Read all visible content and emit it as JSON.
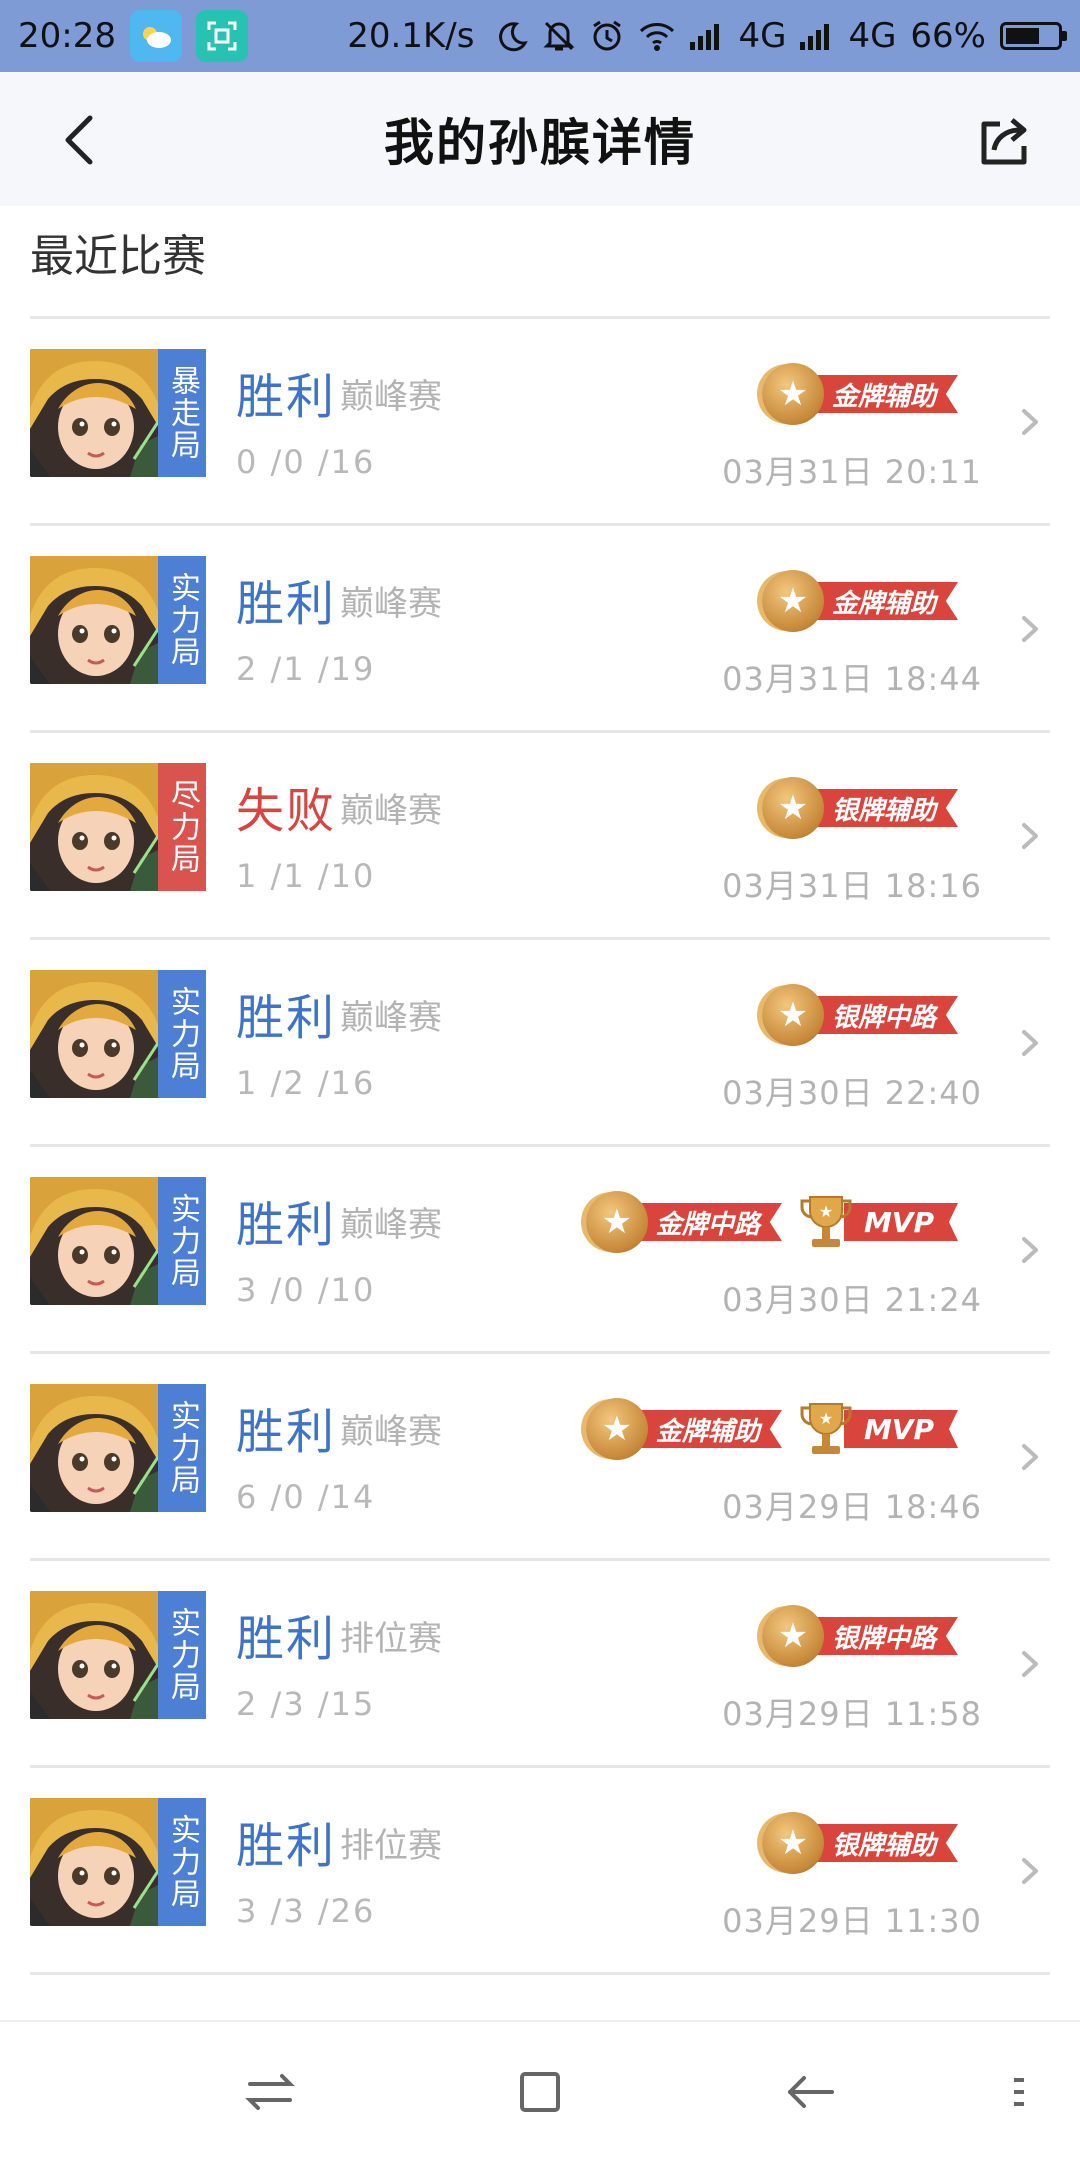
{
  "status_bar": {
    "time": "20:28",
    "speed": "20.1K/s",
    "network1": "4G",
    "network2": "4G",
    "battery": "66%",
    "battery_level": 0.66,
    "icons": [
      "weather-icon",
      "scan-icon",
      "moon-icon",
      "bell-off-icon",
      "alarm-icon",
      "wifi-icon",
      "signal-icon",
      "battery-icon"
    ]
  },
  "header": {
    "title": "我的孙膑详情",
    "back_icon": "chevron-left-icon",
    "share_icon": "share-icon"
  },
  "section": {
    "title": "最近比赛"
  },
  "colors": {
    "win": "#3f73c9",
    "lose": "#d6453f",
    "tag_blue": "#4d7fd4",
    "tag_red": "#d9534f",
    "ribbon": "#d9453c"
  },
  "matches": [
    {
      "tag": "暴走局",
      "tag_color": "blue",
      "result": "胜利",
      "outcome": "win",
      "mode": "巅峰赛",
      "kda": "0 /0 /16",
      "badges": [
        {
          "type": "medal",
          "label": "金牌辅助"
        }
      ],
      "date": "03月31日 20:11"
    },
    {
      "tag": "实力局",
      "tag_color": "blue",
      "result": "胜利",
      "outcome": "win",
      "mode": "巅峰赛",
      "kda": "2 /1 /19",
      "badges": [
        {
          "type": "medal",
          "label": "金牌辅助"
        }
      ],
      "date": "03月31日 18:44"
    },
    {
      "tag": "尽力局",
      "tag_color": "red",
      "result": "失败",
      "outcome": "lose",
      "mode": "巅峰赛",
      "kda": "1 /1 /10",
      "badges": [
        {
          "type": "medal",
          "label": "银牌辅助"
        }
      ],
      "date": "03月31日 18:16"
    },
    {
      "tag": "实力局",
      "tag_color": "blue",
      "result": "胜利",
      "outcome": "win",
      "mode": "巅峰赛",
      "kda": "1 /2 /16",
      "badges": [
        {
          "type": "medal",
          "label": "银牌中路"
        }
      ],
      "date": "03月30日 22:40"
    },
    {
      "tag": "实力局",
      "tag_color": "blue",
      "result": "胜利",
      "outcome": "win",
      "mode": "巅峰赛",
      "kda": "3 /0 /10",
      "badges": [
        {
          "type": "medal",
          "label": "金牌中路"
        },
        {
          "type": "trophy",
          "label": "MVP"
        }
      ],
      "date": "03月30日 21:24"
    },
    {
      "tag": "实力局",
      "tag_color": "blue",
      "result": "胜利",
      "outcome": "win",
      "mode": "巅峰赛",
      "kda": "6 /0 /14",
      "badges": [
        {
          "type": "medal",
          "label": "金牌辅助"
        },
        {
          "type": "trophy",
          "label": "MVP"
        }
      ],
      "date": "03月29日 18:46"
    },
    {
      "tag": "实力局",
      "tag_color": "blue",
      "result": "胜利",
      "outcome": "win",
      "mode": "排位赛",
      "kda": "2 /3 /15",
      "badges": [
        {
          "type": "medal",
          "label": "银牌中路"
        }
      ],
      "date": "03月29日 11:58"
    },
    {
      "tag": "实力局",
      "tag_color": "blue",
      "result": "胜利",
      "outcome": "win",
      "mode": "排位赛",
      "kda": "3 /3 /26",
      "badges": [
        {
          "type": "medal",
          "label": "银牌辅助"
        }
      ],
      "date": "03月29日 11:30"
    }
  ],
  "nav_bar": {
    "icons": [
      "switch-icon",
      "home-square-icon",
      "back-arrow-icon",
      "menu-icon"
    ]
  }
}
